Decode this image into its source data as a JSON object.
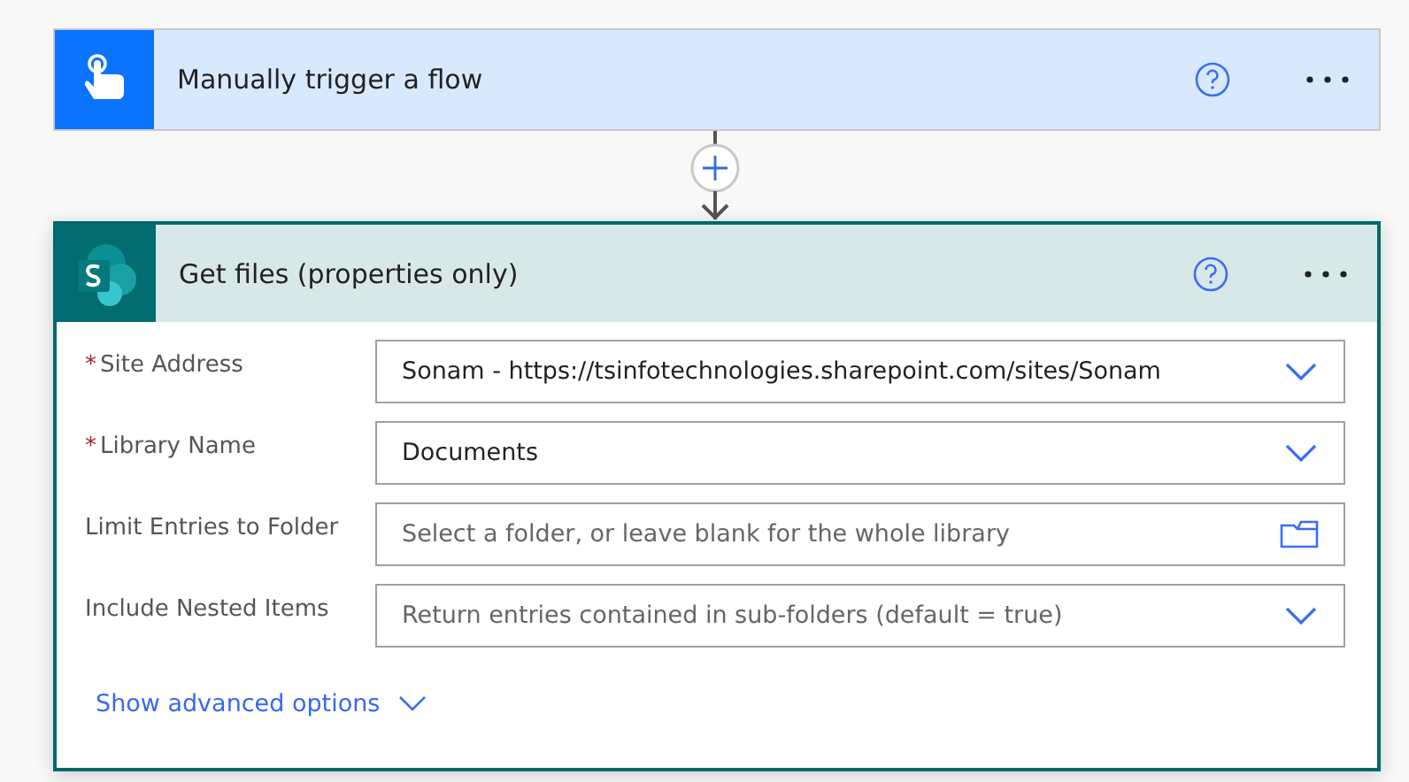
{
  "trigger": {
    "title": "Manually trigger a flow"
  },
  "action": {
    "title": "Get files (properties only)",
    "fields": [
      {
        "mark": "*",
        "label": "Site Address",
        "kind": "dropdown",
        "value": "Sonam - https://tsinfotechnologies.sharepoint.com/sites/Sonam"
      },
      {
        "mark": "*",
        "label": "Library Name",
        "kind": "dropdown",
        "value": "Documents"
      },
      {
        "label": "Limit Entries to Folder",
        "kind": "folder",
        "placeholder": "Select a folder, or leave blank for the whole library"
      },
      {
        "label": "Include Nested Items",
        "kind": "dropdown",
        "placeholder": "Return entries contained in sub-folders (default = true)"
      }
    ],
    "advanced_link": "Show advanced options"
  }
}
